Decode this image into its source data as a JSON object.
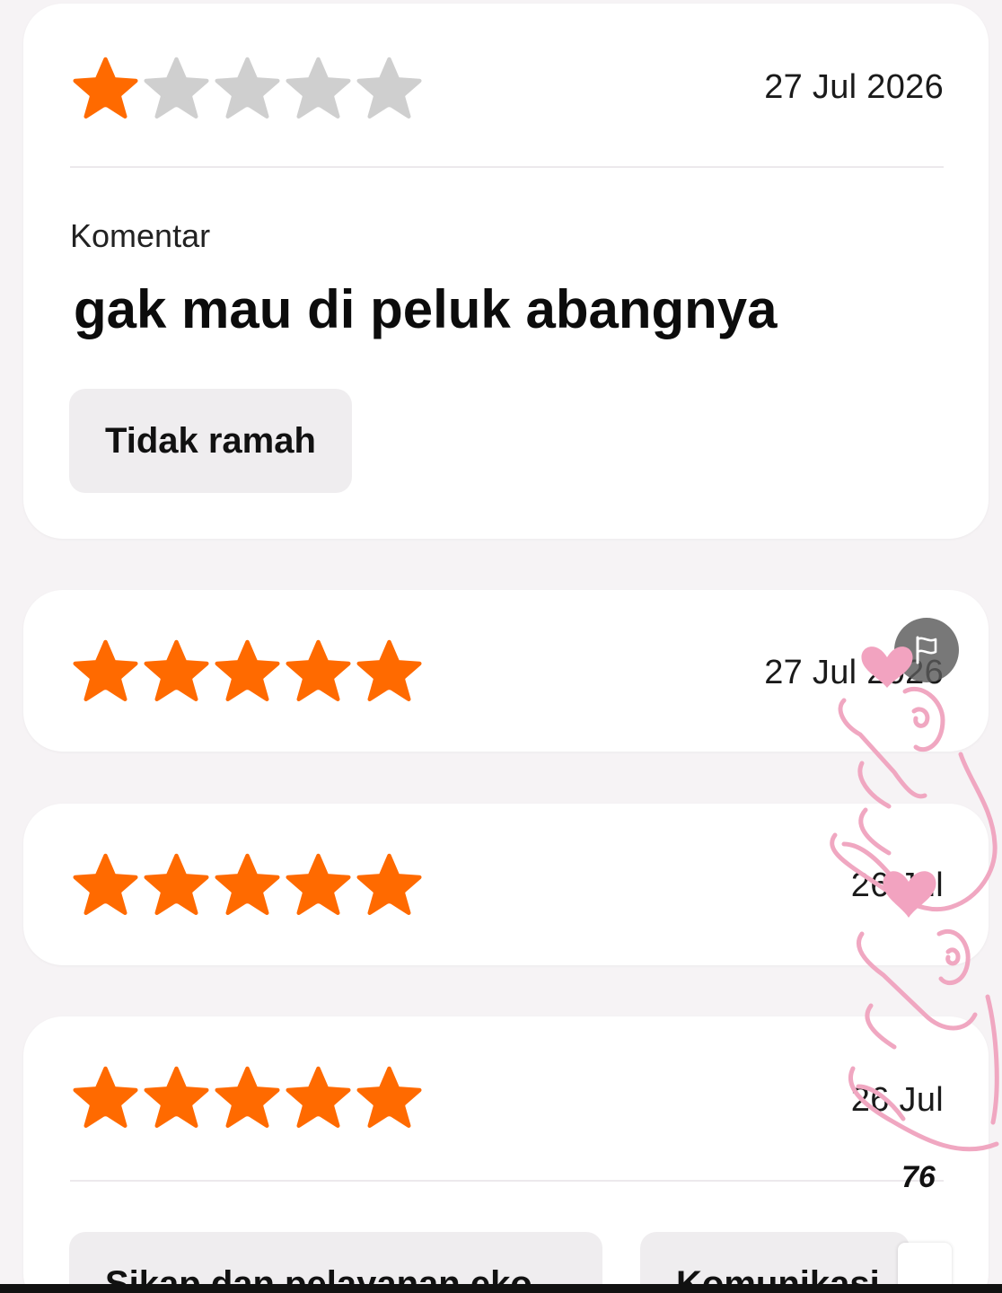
{
  "colors": {
    "star_filled": "#ff6a00",
    "star_empty": "#cfcfcf"
  },
  "reviews": [
    {
      "rating": 1,
      "max_rating": 5,
      "date": "27 Jul 2026",
      "comment_label": "Komentar",
      "comment": "gak mau di peluk abangnya",
      "tags": [
        "Tidak ramah"
      ]
    },
    {
      "rating": 5,
      "max_rating": 5,
      "date": "27 Jul 2026"
    },
    {
      "rating": 5,
      "max_rating": 5,
      "date": "26 Jul"
    },
    {
      "rating": 5,
      "max_rating": 5,
      "date": "26 Jul",
      "tags": [
        "Sikap dan pelayanan eko",
        "Komunikasi"
      ]
    }
  ],
  "overlay": {
    "sticker": "finger-heart-sticker",
    "sticker_text": "76",
    "flag_icon": "flag-icon"
  }
}
